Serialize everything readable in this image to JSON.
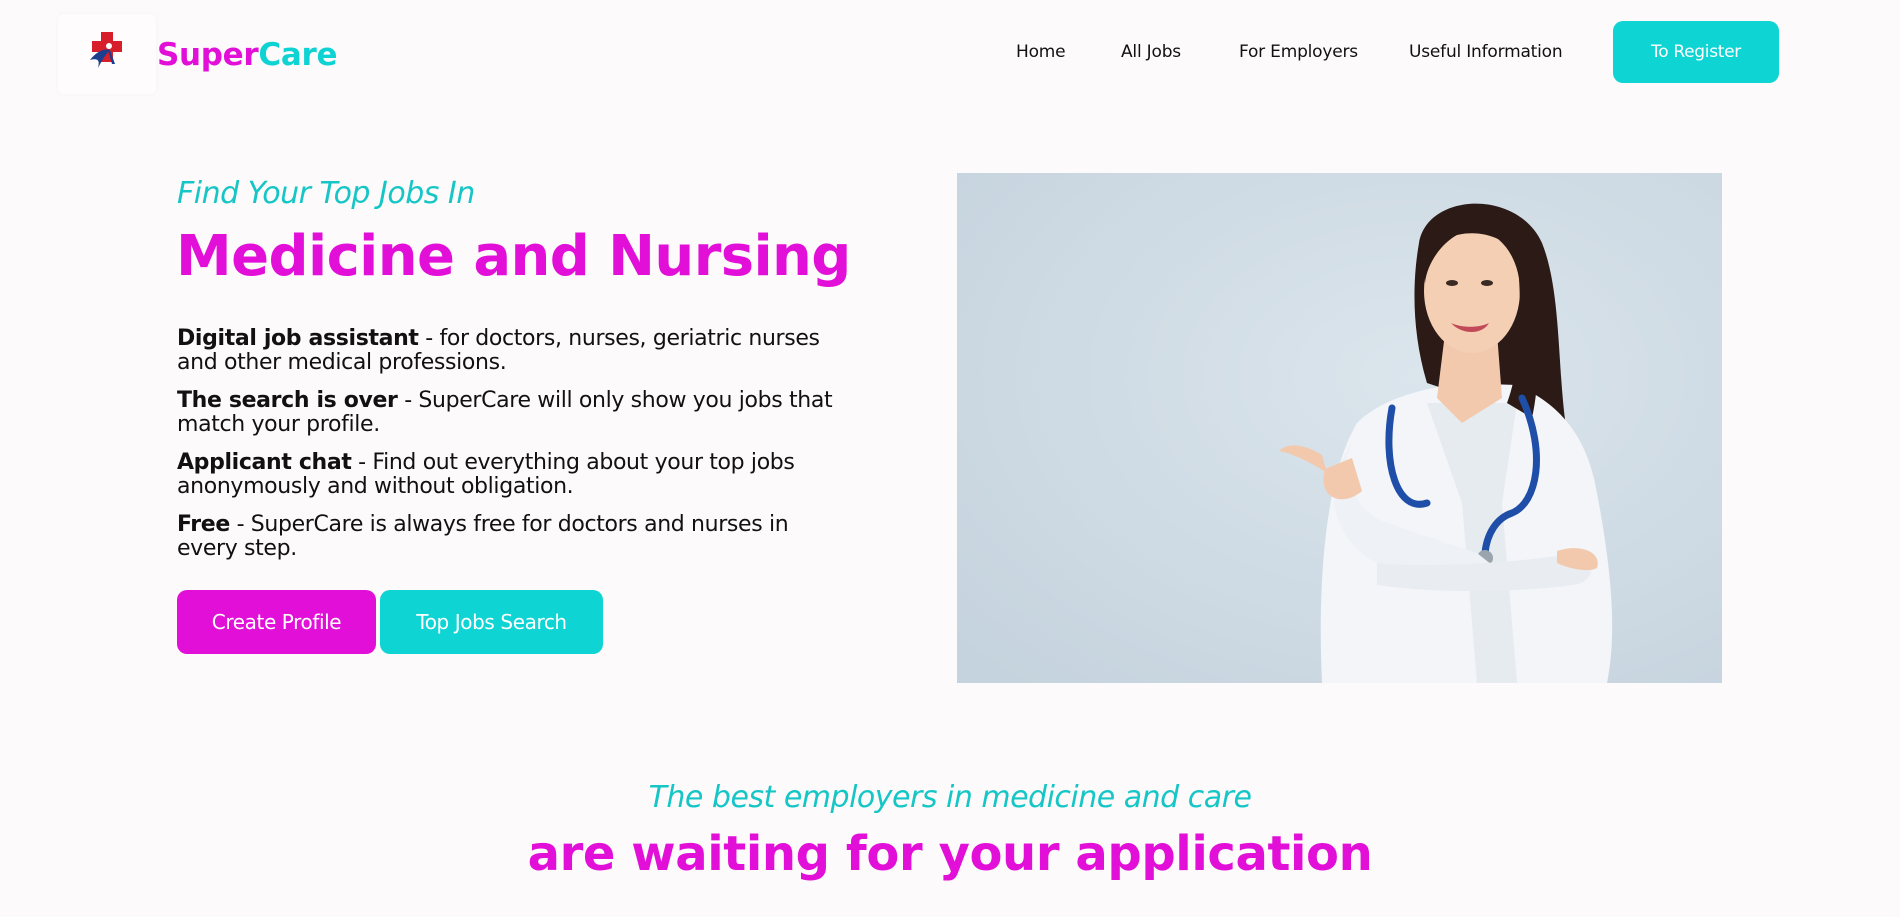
{
  "brand": {
    "part1": "Super",
    "part2": "Care"
  },
  "colors": {
    "magenta": "#e20fd8",
    "cyan": "#0fd4d4",
    "background": "#fdfafb"
  },
  "nav": {
    "items": [
      {
        "label": "Home"
      },
      {
        "label": "All Jobs"
      },
      {
        "label": "For Employers"
      },
      {
        "label": "Useful Information"
      }
    ],
    "register_label": "To Register"
  },
  "hero": {
    "eyebrow": "Find Your Top Jobs In",
    "title": "Medicine and Nursing",
    "features": [
      {
        "title": "Digital job assistant",
        "text": " - for doctors, nurses, geriatric nurses and other medical professions."
      },
      {
        "title": "The search is over",
        "text": " - SuperCare will only show you jobs that match your profile."
      },
      {
        "title": "Applicant chat",
        "text": " - Find out everything about your top jobs anonymously and without obligation."
      },
      {
        "title": "Free",
        "text": " - SuperCare is always free for doctors and nurses in every step."
      }
    ],
    "buttons": {
      "create_profile": "Create Profile",
      "top_jobs_search": "Top Jobs Search"
    },
    "image_icon": "doctor-photo"
  },
  "employers_section": {
    "eyebrow": "The best employers in medicine and care",
    "title": "are waiting for your application"
  }
}
